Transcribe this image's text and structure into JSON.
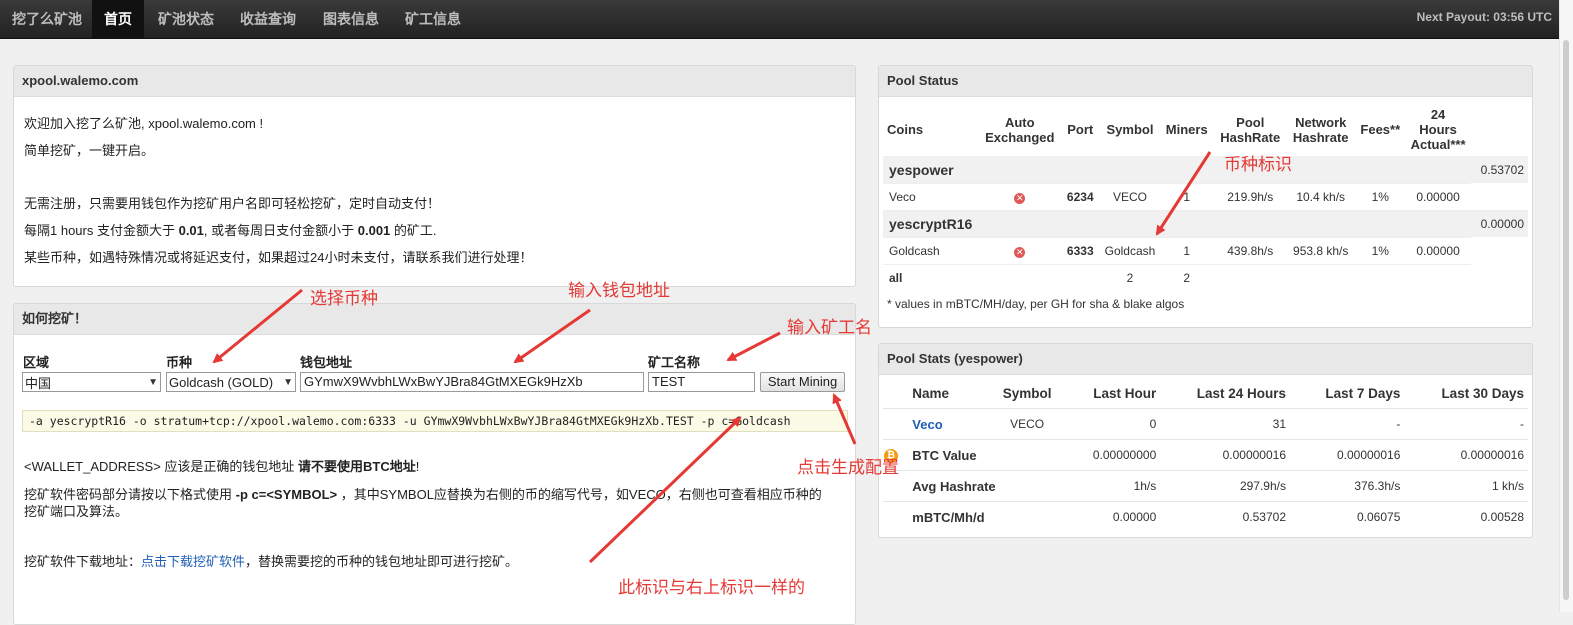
{
  "nav": {
    "brand": "挖了么矿池",
    "items": [
      "首页",
      "矿池状态",
      "收益查询",
      "图表信息",
      "矿工信息"
    ],
    "payout": "Next Payout: 03:56 UTC"
  },
  "intro": {
    "title": "xpool.walemo.com",
    "line1": "欢迎加入挖了么矿池, xpool.walemo.com !",
    "line2": "简单挖矿，一键开启。",
    "line3": "无需注册，只需要用钱包作为挖矿用户名即可轻松挖矿，定时自动支付！",
    "line4_a": "每隔1 hours 支付金额大于 ",
    "line4_b": "0.01",
    "line4_c": ", 或者每周日支付金额小于 ",
    "line4_d": "0.001",
    "line4_e": " 的矿工.",
    "line5": "某些币种，如遇特殊情况或将延迟支付，如果超过24小时未支付，请联系我们进行处理！"
  },
  "howto": {
    "title": "如何挖矿！",
    "region_label": "区域",
    "coin_label": "币种",
    "wallet_label": "钱包地址",
    "worker_label": "矿工名称",
    "region_value": "中国",
    "coin_value": "Goldcash (GOLD)",
    "wallet_value": "GYmwX9WvbhLWxBwYJBra84GtMXEGk9HzXb",
    "worker_value": "TEST",
    "start_label": "Start Mining",
    "command": "-a yescryptR16 -o stratum+tcp://xpool.walemo.com:6333 -u GYmwX9WvbhLWxBwYJBra84GtMXEGk9HzXb.TEST -p c=Goldcash",
    "note1_a": "<WALLET_ADDRESS> 应该是正确的钱包地址 ",
    "note1_b": "请不要使用BTC地址",
    "note1_c": "!",
    "note2_a": "挖矿软件密码部分请按以下格式使用 ",
    "note2_b": "-p c=<SYMBOL>",
    "note2_c": " ，其中SYMBOL应替换为右侧的币的缩写代号，如VECO，右侧也可查看相应币种的",
    "note2_d": "挖矿端口及算法。",
    "note3_a": "挖矿软件下载地址：",
    "note3_link": "点击下载挖矿软件",
    "note3_b": "，替换需要挖的币种的钱包地址即可进行挖矿。"
  },
  "pool_status": {
    "title": "Pool Status",
    "headers": {
      "coins": "Coins",
      "auto1": "Auto",
      "auto2": "Exchanged",
      "port": "Port",
      "symbol": "Symbol",
      "miners": "Miners",
      "phr1": "Pool",
      "phr2": "HashRate",
      "nhr1": "Network",
      "nhr2": "Hashrate",
      "fees": "Fees**",
      "act1": "24",
      "act2": "Hours",
      "act3": "Actual***"
    },
    "groups": [
      {
        "algo": "yespower",
        "value": "0.53702",
        "coin": {
          "name": "Veco",
          "port": "6234",
          "symbol": "VECO",
          "miners": "1",
          "pool_hr": "219.9h/s",
          "net_hr": "10.4 kh/s",
          "fees": "1%",
          "actual": "0.00000"
        }
      },
      {
        "algo": "yescryptR16",
        "value": "0.00000",
        "coin": {
          "name": "Goldcash",
          "port": "6333",
          "symbol": "Goldcash",
          "miners": "1",
          "pool_hr": "439.8h/s",
          "net_hr": "953.8 kh/s",
          "fees": "1%",
          "actual": "0.00000"
        }
      }
    ],
    "all": {
      "label": "all",
      "symbol": "2",
      "miners": "2"
    },
    "footnote": "* values in mBTC/MH/day, per GH for sha & blake algos"
  },
  "pool_stats": {
    "title": "Pool Stats (yespower)",
    "headers": [
      "Name",
      "Symbol",
      "Last Hour",
      "Last 24 Hours",
      "Last 7 Days",
      "Last 30 Days"
    ],
    "rows": [
      {
        "name": "Veco",
        "symbol": "VECO",
        "v": [
          "0",
          "31",
          "-",
          "-"
        ]
      },
      {
        "name": "BTC Value",
        "symbol": "",
        "v": [
          "0.00000000",
          "0.00000016",
          "0.00000016",
          "0.00000016"
        ]
      },
      {
        "name": "Avg Hashrate",
        "symbol": "",
        "v": [
          "1h/s",
          "297.9h/s",
          "376.3h/s",
          "1 kh/s"
        ]
      },
      {
        "name": "mBTC/Mh/d",
        "symbol": "",
        "v": [
          "0.00000",
          "0.53702",
          "0.06075",
          "0.00528"
        ]
      }
    ]
  },
  "annotations": {
    "select_coin": "选择币种",
    "input_wallet": "输入钱包地址",
    "input_worker": "输入矿工名",
    "click_generate": "点击生成配置",
    "coin_mark": "币种标识",
    "same_mark": "此标识与右上标识一样的"
  },
  "colors": {
    "arrow": "#e53935",
    "link": "#1f5fb6",
    "error": "#e05757",
    "btc": "#f39c12"
  }
}
